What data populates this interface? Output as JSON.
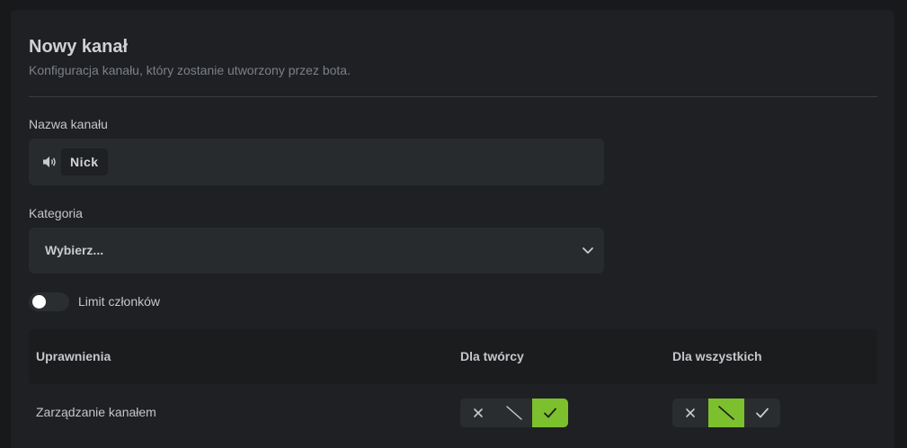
{
  "header": {
    "title": "Nowy kanał",
    "subtitle": "Konfiguracja kanału, który zostanie utworzony przez bota."
  },
  "channel_name": {
    "label": "Nazwa kanału",
    "icon": "speaker-icon",
    "tag": "Nick"
  },
  "category": {
    "label": "Kategoria",
    "selected": "Wybierz..."
  },
  "member_limit": {
    "label": "Limit członków",
    "enabled": false
  },
  "permissions_table": {
    "headers": [
      "Uprawnienia",
      "Dla twórcy",
      "Dla wszystkich"
    ],
    "rows": [
      {
        "label": "Zarządzanie kanałem",
        "creator": "allow",
        "everyone": "neutral"
      }
    ]
  },
  "colors": {
    "accent": "#7cc02e",
    "background": "#17191b",
    "card": "#1e2023",
    "input": "#282b2e"
  }
}
